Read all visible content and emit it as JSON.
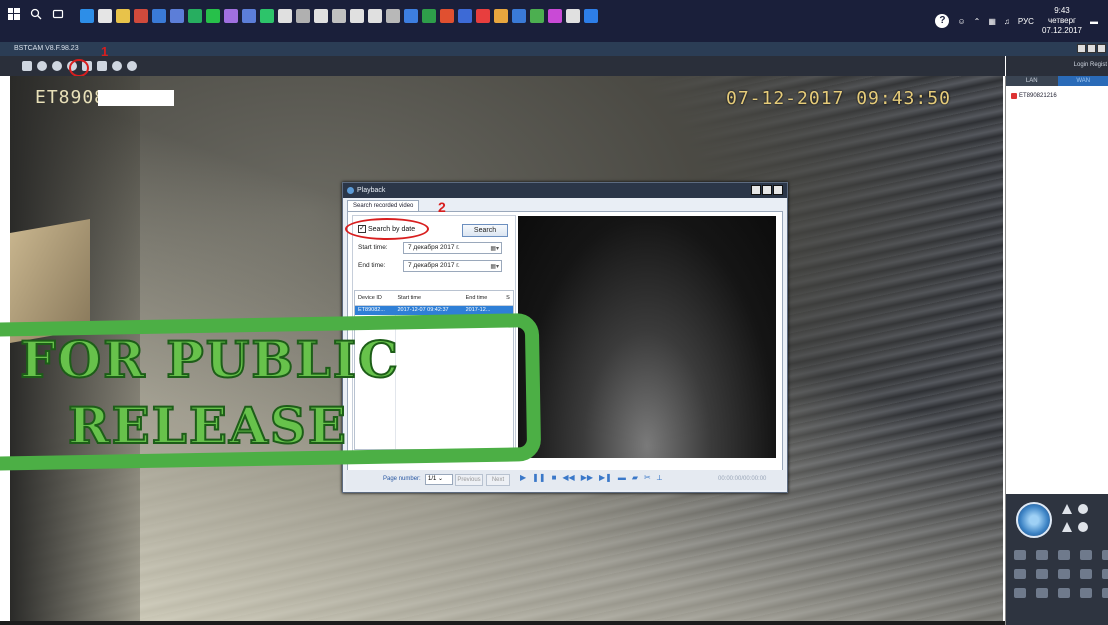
{
  "taskbar": {
    "lang": "РУС",
    "clock_time": "9:43",
    "clock_day": "четверг",
    "clock_date": "07.12.2017",
    "app_colors": [
      "#2d8ee8",
      "#e5e5e5",
      "#e8c34a",
      "#d04a3c",
      "#3a7ad6",
      "#5c7ed8",
      "#27ae60",
      "#27c04a",
      "#a070e0",
      "#5c7ed8",
      "#2dc46a",
      "#e0e0e0",
      "#b0b0b0",
      "#e0e0e0",
      "#c0c0c0",
      "#e0e0e0",
      "#e0e0e0",
      "#b8b8b8",
      "#3d7ee0",
      "#2e9e4a",
      "#e05030",
      "#3d6ad6",
      "#e83e3e",
      "#e8a63e",
      "#3a7ad6",
      "#4caf50",
      "#c94ad6",
      "#e0e0e0",
      "#2d7ee8"
    ]
  },
  "app": {
    "title": "BSTCAM V8.F.98.23",
    "marker_1": "1",
    "marker_2": "2"
  },
  "video": {
    "camera_id": "ET8908",
    "timestamp": "07-12-2017  09:43:50"
  },
  "right_panel": {
    "top_links": "Login  Regist",
    "tab_lan": "LAN",
    "tab_wan": "WAN",
    "device": "ET890821216"
  },
  "playback": {
    "title": "Playback",
    "tab": "Search recorded video",
    "search_by_date": "Search by date",
    "search_button": "Search",
    "start_label": "Start time:",
    "start_value": "7 декабря 2017 г.",
    "end_label": "End time:",
    "end_value": "7 декабря 2017 г.",
    "columns": [
      "Device ID",
      "Start time",
      "End time",
      "S"
    ],
    "row": [
      "ET89082...",
      "2017-12-07 09:42:37",
      "2017-12...",
      ""
    ],
    "page_label": "Page number:",
    "page_value": "1/1",
    "previous": "Previous",
    "next": "Next",
    "time_display": "00:00:00/00:00:00"
  },
  "stamp": {
    "line1": "FOR PUBLIC",
    "line2": "RELEASE",
    "color": "#4caf45"
  }
}
